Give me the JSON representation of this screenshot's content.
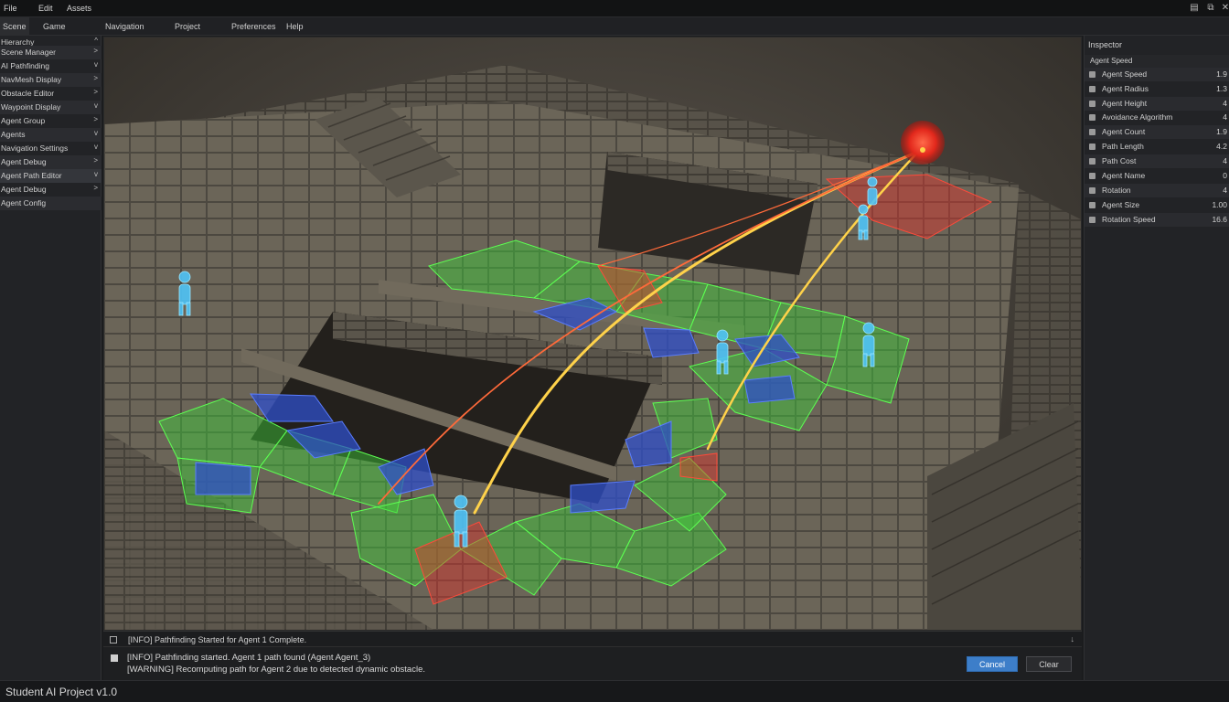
{
  "menubar": {
    "items": [
      "File",
      "Edit",
      "Assets"
    ],
    "window_controls": [
      "▤",
      "⧉",
      "✕"
    ]
  },
  "toolbar": {
    "items": [
      "Scene",
      "Game",
      "Navigation",
      "Project",
      "Preferences",
      "Help"
    ]
  },
  "left_panel": {
    "items": [
      {
        "label": "Hierarchy",
        "chevron": "^"
      },
      {
        "label": "Scene Manager",
        "chevron": ">"
      },
      {
        "label": "AI Pathfinding",
        "chevron": "v"
      },
      {
        "label": "NavMesh Display",
        "chevron": ">"
      },
      {
        "label": "Obstacle Editor",
        "chevron": ">"
      },
      {
        "label": "Waypoint Display",
        "chevron": "v"
      },
      {
        "label": "Agent Group",
        "chevron": ">"
      },
      {
        "label": "Agents",
        "chevron": "v"
      },
      {
        "label": "Navigation Settings",
        "chevron": "v"
      },
      {
        "label": "Agent Debug",
        "chevron": ">"
      },
      {
        "label": "Agent Path Editor",
        "chevron": "v"
      },
      {
        "label": "Agent Debug",
        "chevron": ">"
      },
      {
        "label": "Agent Config",
        "chevron": ""
      }
    ]
  },
  "inspector": {
    "title": "Inspector",
    "section": "Agent Speed",
    "rows": [
      {
        "label": "Agent Speed",
        "value": "1.9"
      },
      {
        "label": "Agent Radius",
        "value": "1.3"
      },
      {
        "label": "Agent Height",
        "value": "4"
      },
      {
        "label": "Avoidance Algorithm",
        "value": "4"
      },
      {
        "label": "Agent Count",
        "value": "1.9"
      },
      {
        "label": "Path Length",
        "value": "4.2"
      },
      {
        "label": "Path Cost",
        "value": "4"
      },
      {
        "label": "Agent Name",
        "value": "0"
      },
      {
        "label": "Rotation",
        "value": "4"
      },
      {
        "label": "Agent Size",
        "value": "1.00"
      },
      {
        "label": "Rotation Speed",
        "value": "16.6"
      }
    ]
  },
  "console": {
    "header": "[INFO] Pathfinding Started for Agent 1 Complete.",
    "lines": [
      "[INFO] Pathfinding started. Agent 1 path found (Agent Agent_3)",
      "[WARNING] Recomputing path for Agent 2 due to detected dynamic obstacle."
    ],
    "primary_button": "Cancel",
    "secondary_button": "Clear"
  },
  "statusbar": {
    "text": "Student AI Project v1.0"
  },
  "colors": {
    "navmesh_walkable": "#3fd13a",
    "navmesh_blocked": "#e0342c",
    "navmesh_water": "#2f4fc9",
    "path_primary": "#ffd24a",
    "path_secondary": "#ff6a3a",
    "agent": "#4fc3f7",
    "target": "#ff3b2e",
    "accent_button": "#3d7ec9"
  },
  "agents": [
    {
      "id": "agent-1"
    },
    {
      "id": "agent-2"
    },
    {
      "id": "agent-3"
    },
    {
      "id": "agent-4"
    },
    {
      "id": "agent-5"
    },
    {
      "id": "agent-6"
    }
  ]
}
